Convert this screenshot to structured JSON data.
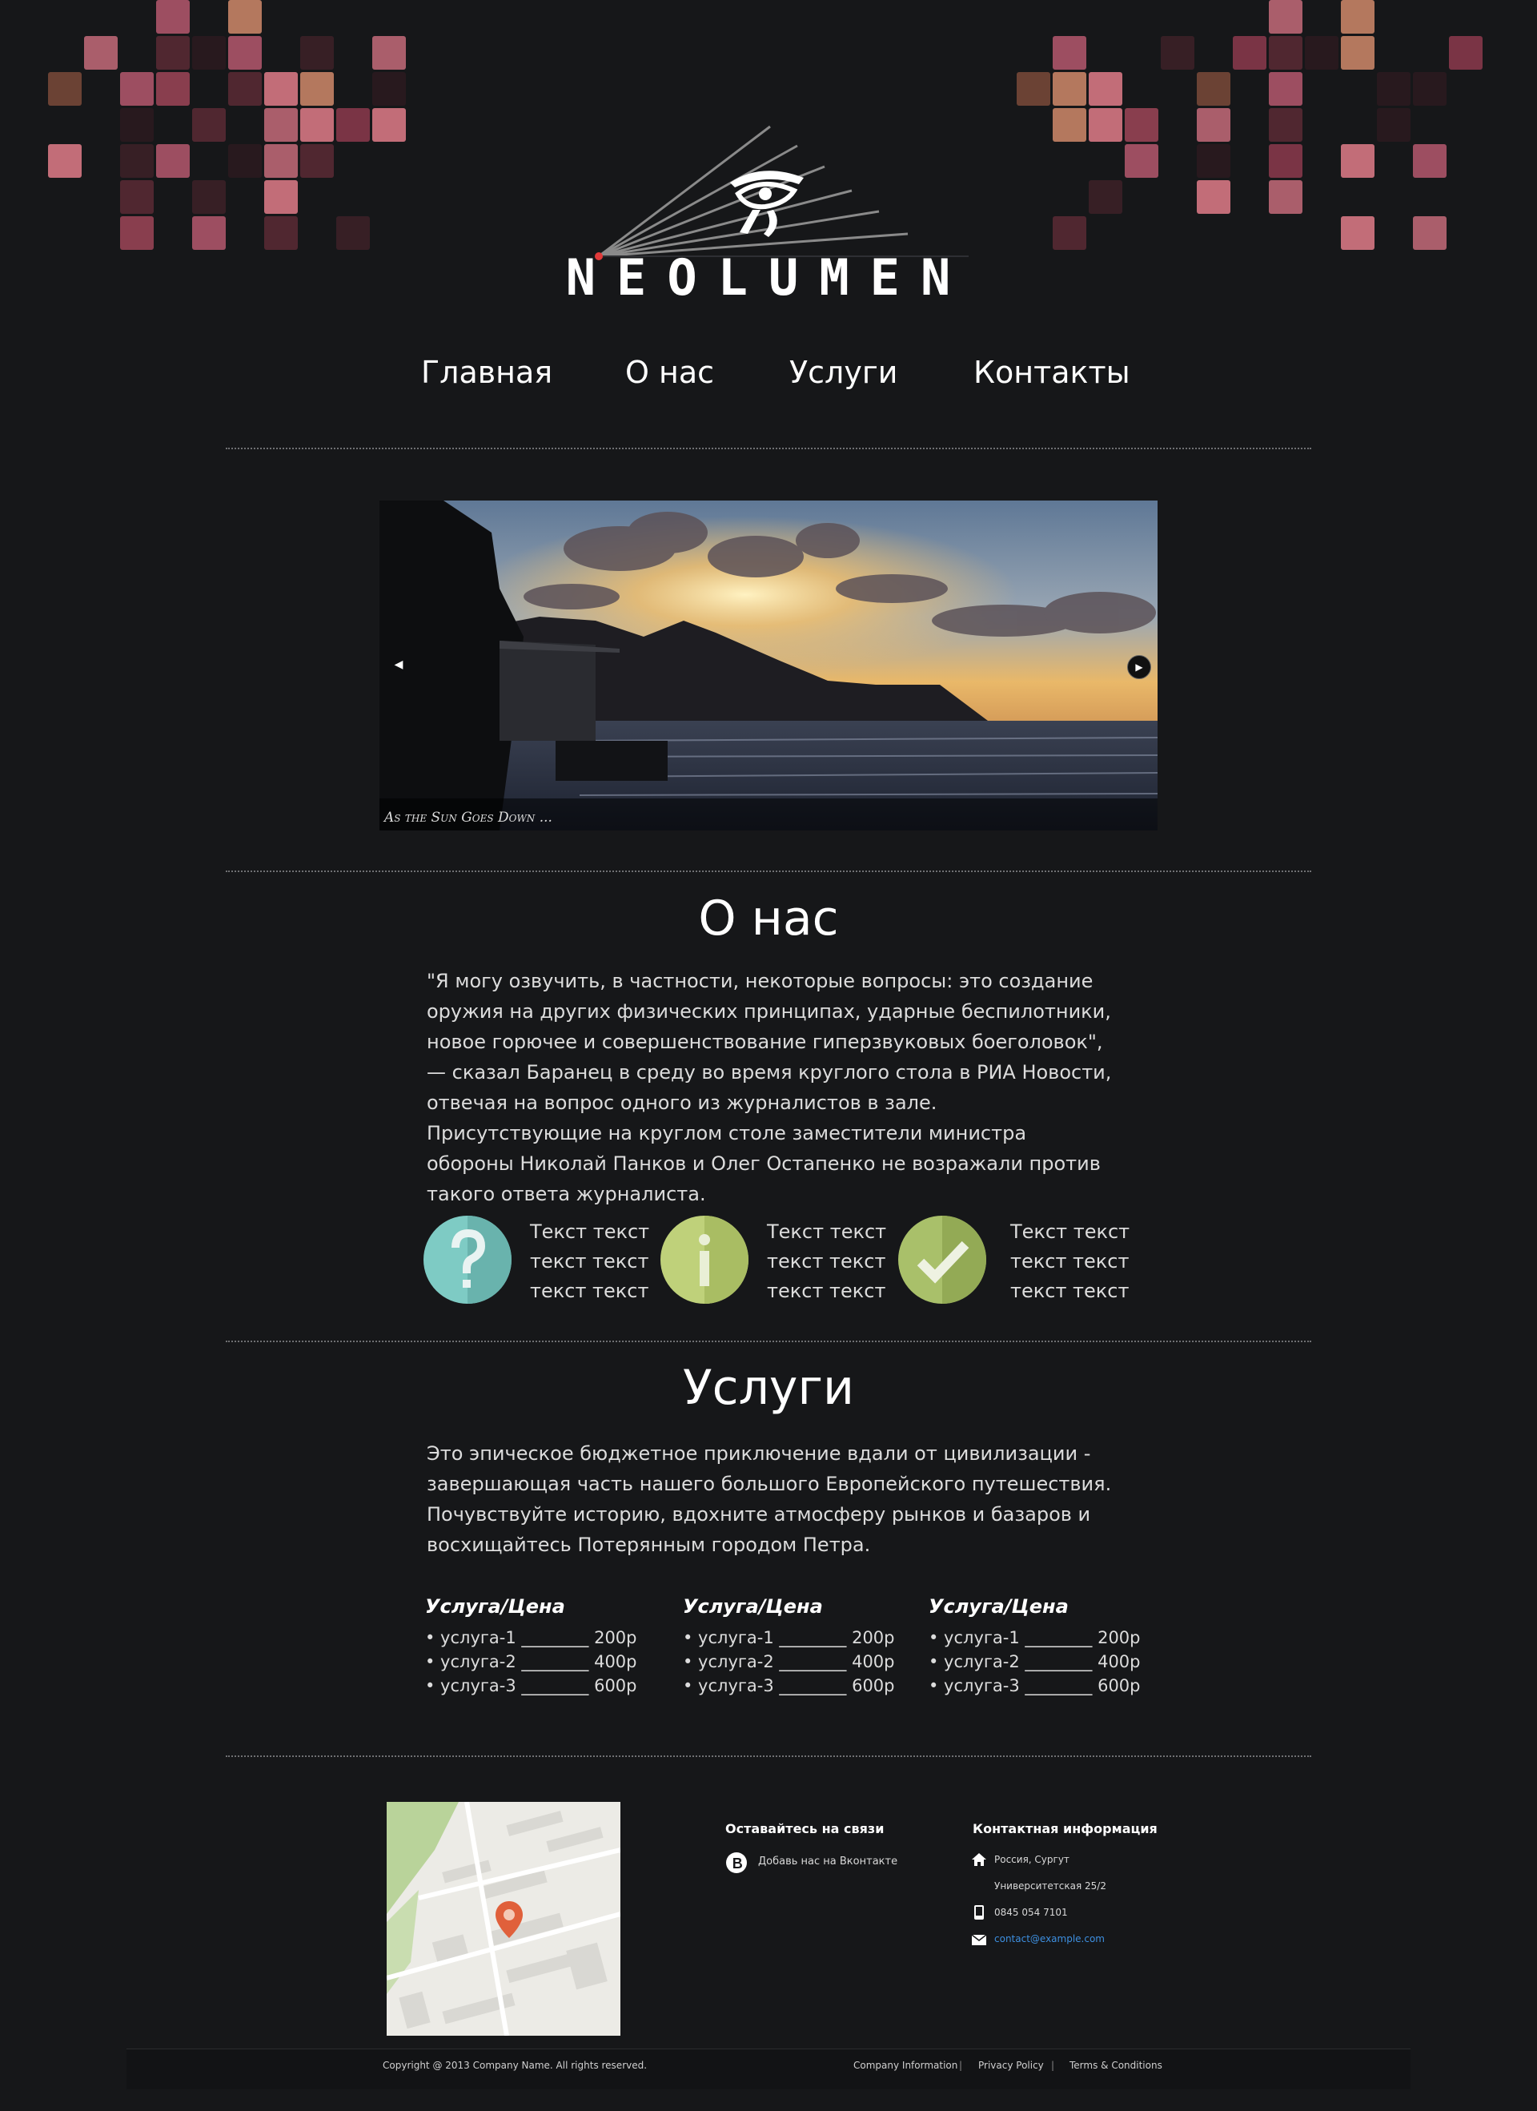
{
  "brand": {
    "name": "NEOLUMEN"
  },
  "nav": {
    "items": [
      {
        "label": "Главная"
      },
      {
        "label": "О нас"
      },
      {
        "label": "Услуги"
      },
      {
        "label": "Контакты"
      }
    ]
  },
  "slider": {
    "caption": "As the Sun Goes Down ...",
    "prev_icon": "prev-arrow-icon",
    "next_icon": "next-arrow-icon"
  },
  "about": {
    "title": "О нас",
    "text": "\"Я могу озвучить, в частности, некоторые вопросы: это создание оружия на других физических принципах, ударные беспилотники, новое горючее и совершенствование гиперзвуковых боеголовок\", — сказал Баранец в среду во время круглого стола в РИА Новости, отвечая на вопрос одного из журналистов в зале. Присутствующие на круглом столе заместители министра обороны Николай Панков и Олег Остапенко не возражали против такого ответа журналиста.",
    "features": [
      {
        "icon": "question-icon",
        "color": "#7ecbc4",
        "lines": [
          "Текст текст",
          "текст текст",
          "текст текст"
        ]
      },
      {
        "icon": "info-icon",
        "color": "#b6c96a",
        "lines": [
          "Текст текст",
          "текст текст",
          "текст текст"
        ]
      },
      {
        "icon": "checkmark-icon",
        "color": "#a4bb60",
        "lines": [
          "Текст текст",
          "текст текст",
          "текст текст"
        ]
      }
    ]
  },
  "services": {
    "title": "Услуги",
    "text": "Это эпическое бюджетное приключение вдали от цивилизации - завершающая часть нашего большого Европейского путешествия. Почувствуйте историю, вдохните атмосферу рынков и базаров и восхищайтесь Потерянным городом Петра.",
    "columns": [
      {
        "title": "Услуга/Цена",
        "items": [
          "• услуга-1 ________ 200р",
          "• услуга-2 ________ 400р",
          "• услуга-3 ________ 600р"
        ]
      },
      {
        "title": "Услуга/Цена",
        "items": [
          "• услуга-1 ________ 200р",
          "• услуга-2 ________ 400р",
          "• услуга-3 ________ 600р"
        ]
      },
      {
        "title": "Услуга/Цена",
        "items": [
          "• услуга-1 ________ 200р",
          "• услуга-2 ________ 400р",
          "• услуга-3 ________ 600р"
        ]
      }
    ]
  },
  "footer": {
    "social": {
      "title": "Оставайтесь на связи",
      "vk_label": "Добавь нас на Вконтакте",
      "vk_icon": "vk-icon"
    },
    "contact": {
      "title": "Контактная информация",
      "address_line1": "Россия, Сургут",
      "address_line2": "Университетская 25/2",
      "phone": "0845 054 7101",
      "email": "contact@example.com",
      "email_color": "#3d8fe0"
    },
    "copyright": "Copyright @ 2013 Company Name. All rights reserved.",
    "links": [
      "Company Information",
      "Privacy Policy",
      "Terms & Conditions"
    ],
    "separator": "|"
  }
}
